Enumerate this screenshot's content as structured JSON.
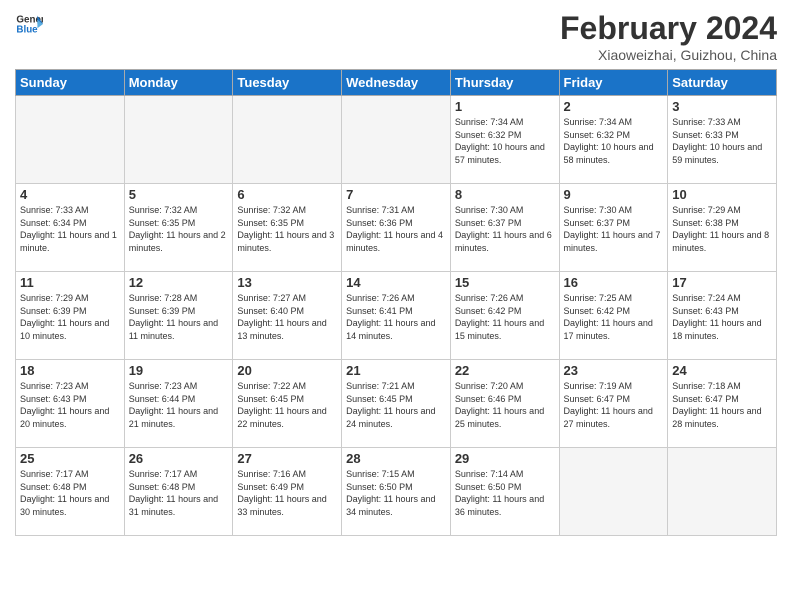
{
  "header": {
    "logo_general": "General",
    "logo_blue": "Blue",
    "title": "February 2024",
    "subtitle": "Xiaoweizhai, Guizhou, China"
  },
  "days_of_week": [
    "Sunday",
    "Monday",
    "Tuesday",
    "Wednesday",
    "Thursday",
    "Friday",
    "Saturday"
  ],
  "weeks": [
    [
      {
        "day": "",
        "info": ""
      },
      {
        "day": "",
        "info": ""
      },
      {
        "day": "",
        "info": ""
      },
      {
        "day": "",
        "info": ""
      },
      {
        "day": "1",
        "info": "Sunrise: 7:34 AM\nSunset: 6:32 PM\nDaylight: 10 hours and 57 minutes."
      },
      {
        "day": "2",
        "info": "Sunrise: 7:34 AM\nSunset: 6:32 PM\nDaylight: 10 hours and 58 minutes."
      },
      {
        "day": "3",
        "info": "Sunrise: 7:33 AM\nSunset: 6:33 PM\nDaylight: 10 hours and 59 minutes."
      }
    ],
    [
      {
        "day": "4",
        "info": "Sunrise: 7:33 AM\nSunset: 6:34 PM\nDaylight: 11 hours and 1 minute."
      },
      {
        "day": "5",
        "info": "Sunrise: 7:32 AM\nSunset: 6:35 PM\nDaylight: 11 hours and 2 minutes."
      },
      {
        "day": "6",
        "info": "Sunrise: 7:32 AM\nSunset: 6:35 PM\nDaylight: 11 hours and 3 minutes."
      },
      {
        "day": "7",
        "info": "Sunrise: 7:31 AM\nSunset: 6:36 PM\nDaylight: 11 hours and 4 minutes."
      },
      {
        "day": "8",
        "info": "Sunrise: 7:30 AM\nSunset: 6:37 PM\nDaylight: 11 hours and 6 minutes."
      },
      {
        "day": "9",
        "info": "Sunrise: 7:30 AM\nSunset: 6:37 PM\nDaylight: 11 hours and 7 minutes."
      },
      {
        "day": "10",
        "info": "Sunrise: 7:29 AM\nSunset: 6:38 PM\nDaylight: 11 hours and 8 minutes."
      }
    ],
    [
      {
        "day": "11",
        "info": "Sunrise: 7:29 AM\nSunset: 6:39 PM\nDaylight: 11 hours and 10 minutes."
      },
      {
        "day": "12",
        "info": "Sunrise: 7:28 AM\nSunset: 6:39 PM\nDaylight: 11 hours and 11 minutes."
      },
      {
        "day": "13",
        "info": "Sunrise: 7:27 AM\nSunset: 6:40 PM\nDaylight: 11 hours and 13 minutes."
      },
      {
        "day": "14",
        "info": "Sunrise: 7:26 AM\nSunset: 6:41 PM\nDaylight: 11 hours and 14 minutes."
      },
      {
        "day": "15",
        "info": "Sunrise: 7:26 AM\nSunset: 6:42 PM\nDaylight: 11 hours and 15 minutes."
      },
      {
        "day": "16",
        "info": "Sunrise: 7:25 AM\nSunset: 6:42 PM\nDaylight: 11 hours and 17 minutes."
      },
      {
        "day": "17",
        "info": "Sunrise: 7:24 AM\nSunset: 6:43 PM\nDaylight: 11 hours and 18 minutes."
      }
    ],
    [
      {
        "day": "18",
        "info": "Sunrise: 7:23 AM\nSunset: 6:43 PM\nDaylight: 11 hours and 20 minutes."
      },
      {
        "day": "19",
        "info": "Sunrise: 7:23 AM\nSunset: 6:44 PM\nDaylight: 11 hours and 21 minutes."
      },
      {
        "day": "20",
        "info": "Sunrise: 7:22 AM\nSunset: 6:45 PM\nDaylight: 11 hours and 22 minutes."
      },
      {
        "day": "21",
        "info": "Sunrise: 7:21 AM\nSunset: 6:45 PM\nDaylight: 11 hours and 24 minutes."
      },
      {
        "day": "22",
        "info": "Sunrise: 7:20 AM\nSunset: 6:46 PM\nDaylight: 11 hours and 25 minutes."
      },
      {
        "day": "23",
        "info": "Sunrise: 7:19 AM\nSunset: 6:47 PM\nDaylight: 11 hours and 27 minutes."
      },
      {
        "day": "24",
        "info": "Sunrise: 7:18 AM\nSunset: 6:47 PM\nDaylight: 11 hours and 28 minutes."
      }
    ],
    [
      {
        "day": "25",
        "info": "Sunrise: 7:17 AM\nSunset: 6:48 PM\nDaylight: 11 hours and 30 minutes."
      },
      {
        "day": "26",
        "info": "Sunrise: 7:17 AM\nSunset: 6:48 PM\nDaylight: 11 hours and 31 minutes."
      },
      {
        "day": "27",
        "info": "Sunrise: 7:16 AM\nSunset: 6:49 PM\nDaylight: 11 hours and 33 minutes."
      },
      {
        "day": "28",
        "info": "Sunrise: 7:15 AM\nSunset: 6:50 PM\nDaylight: 11 hours and 34 minutes."
      },
      {
        "day": "29",
        "info": "Sunrise: 7:14 AM\nSunset: 6:50 PM\nDaylight: 11 hours and 36 minutes."
      },
      {
        "day": "",
        "info": ""
      },
      {
        "day": "",
        "info": ""
      }
    ]
  ]
}
